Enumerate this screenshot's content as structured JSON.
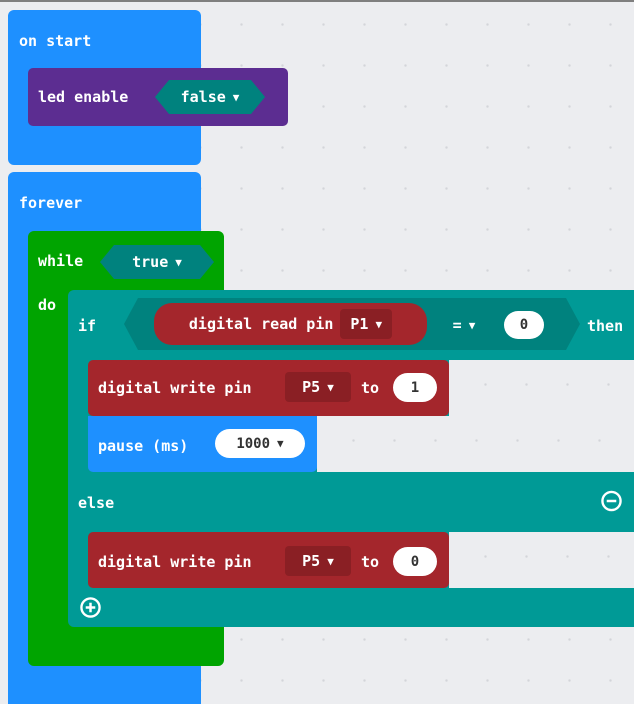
{
  "on_start": {
    "label": "on start",
    "led_enable": {
      "label": "led enable",
      "value": "false"
    }
  },
  "forever": {
    "label": "forever",
    "while": {
      "label": "while",
      "condition": "true",
      "do_label": "do",
      "if_block": {
        "if_label": "if",
        "then_label": "then",
        "else_label": "else",
        "condition": {
          "read_label": "digital read pin",
          "read_pin": "P1",
          "operator": "=",
          "compare_value": "0"
        },
        "then_statements": {
          "write_label": "digital write pin",
          "write_pin": "P5",
          "to_label": "to",
          "write_value": "1",
          "pause_label": "pause (ms)",
          "pause_value": "1000"
        },
        "else_statements": {
          "write_label": "digital write pin",
          "write_pin": "P5",
          "to_label": "to",
          "write_value": "0"
        }
      }
    }
  },
  "colors": {
    "basic": "#1e90ff",
    "variables_purple": "#5c2d91",
    "loops_green": "#00a400",
    "logic_teal": "#009a96",
    "pins_red": "#a4262c"
  }
}
